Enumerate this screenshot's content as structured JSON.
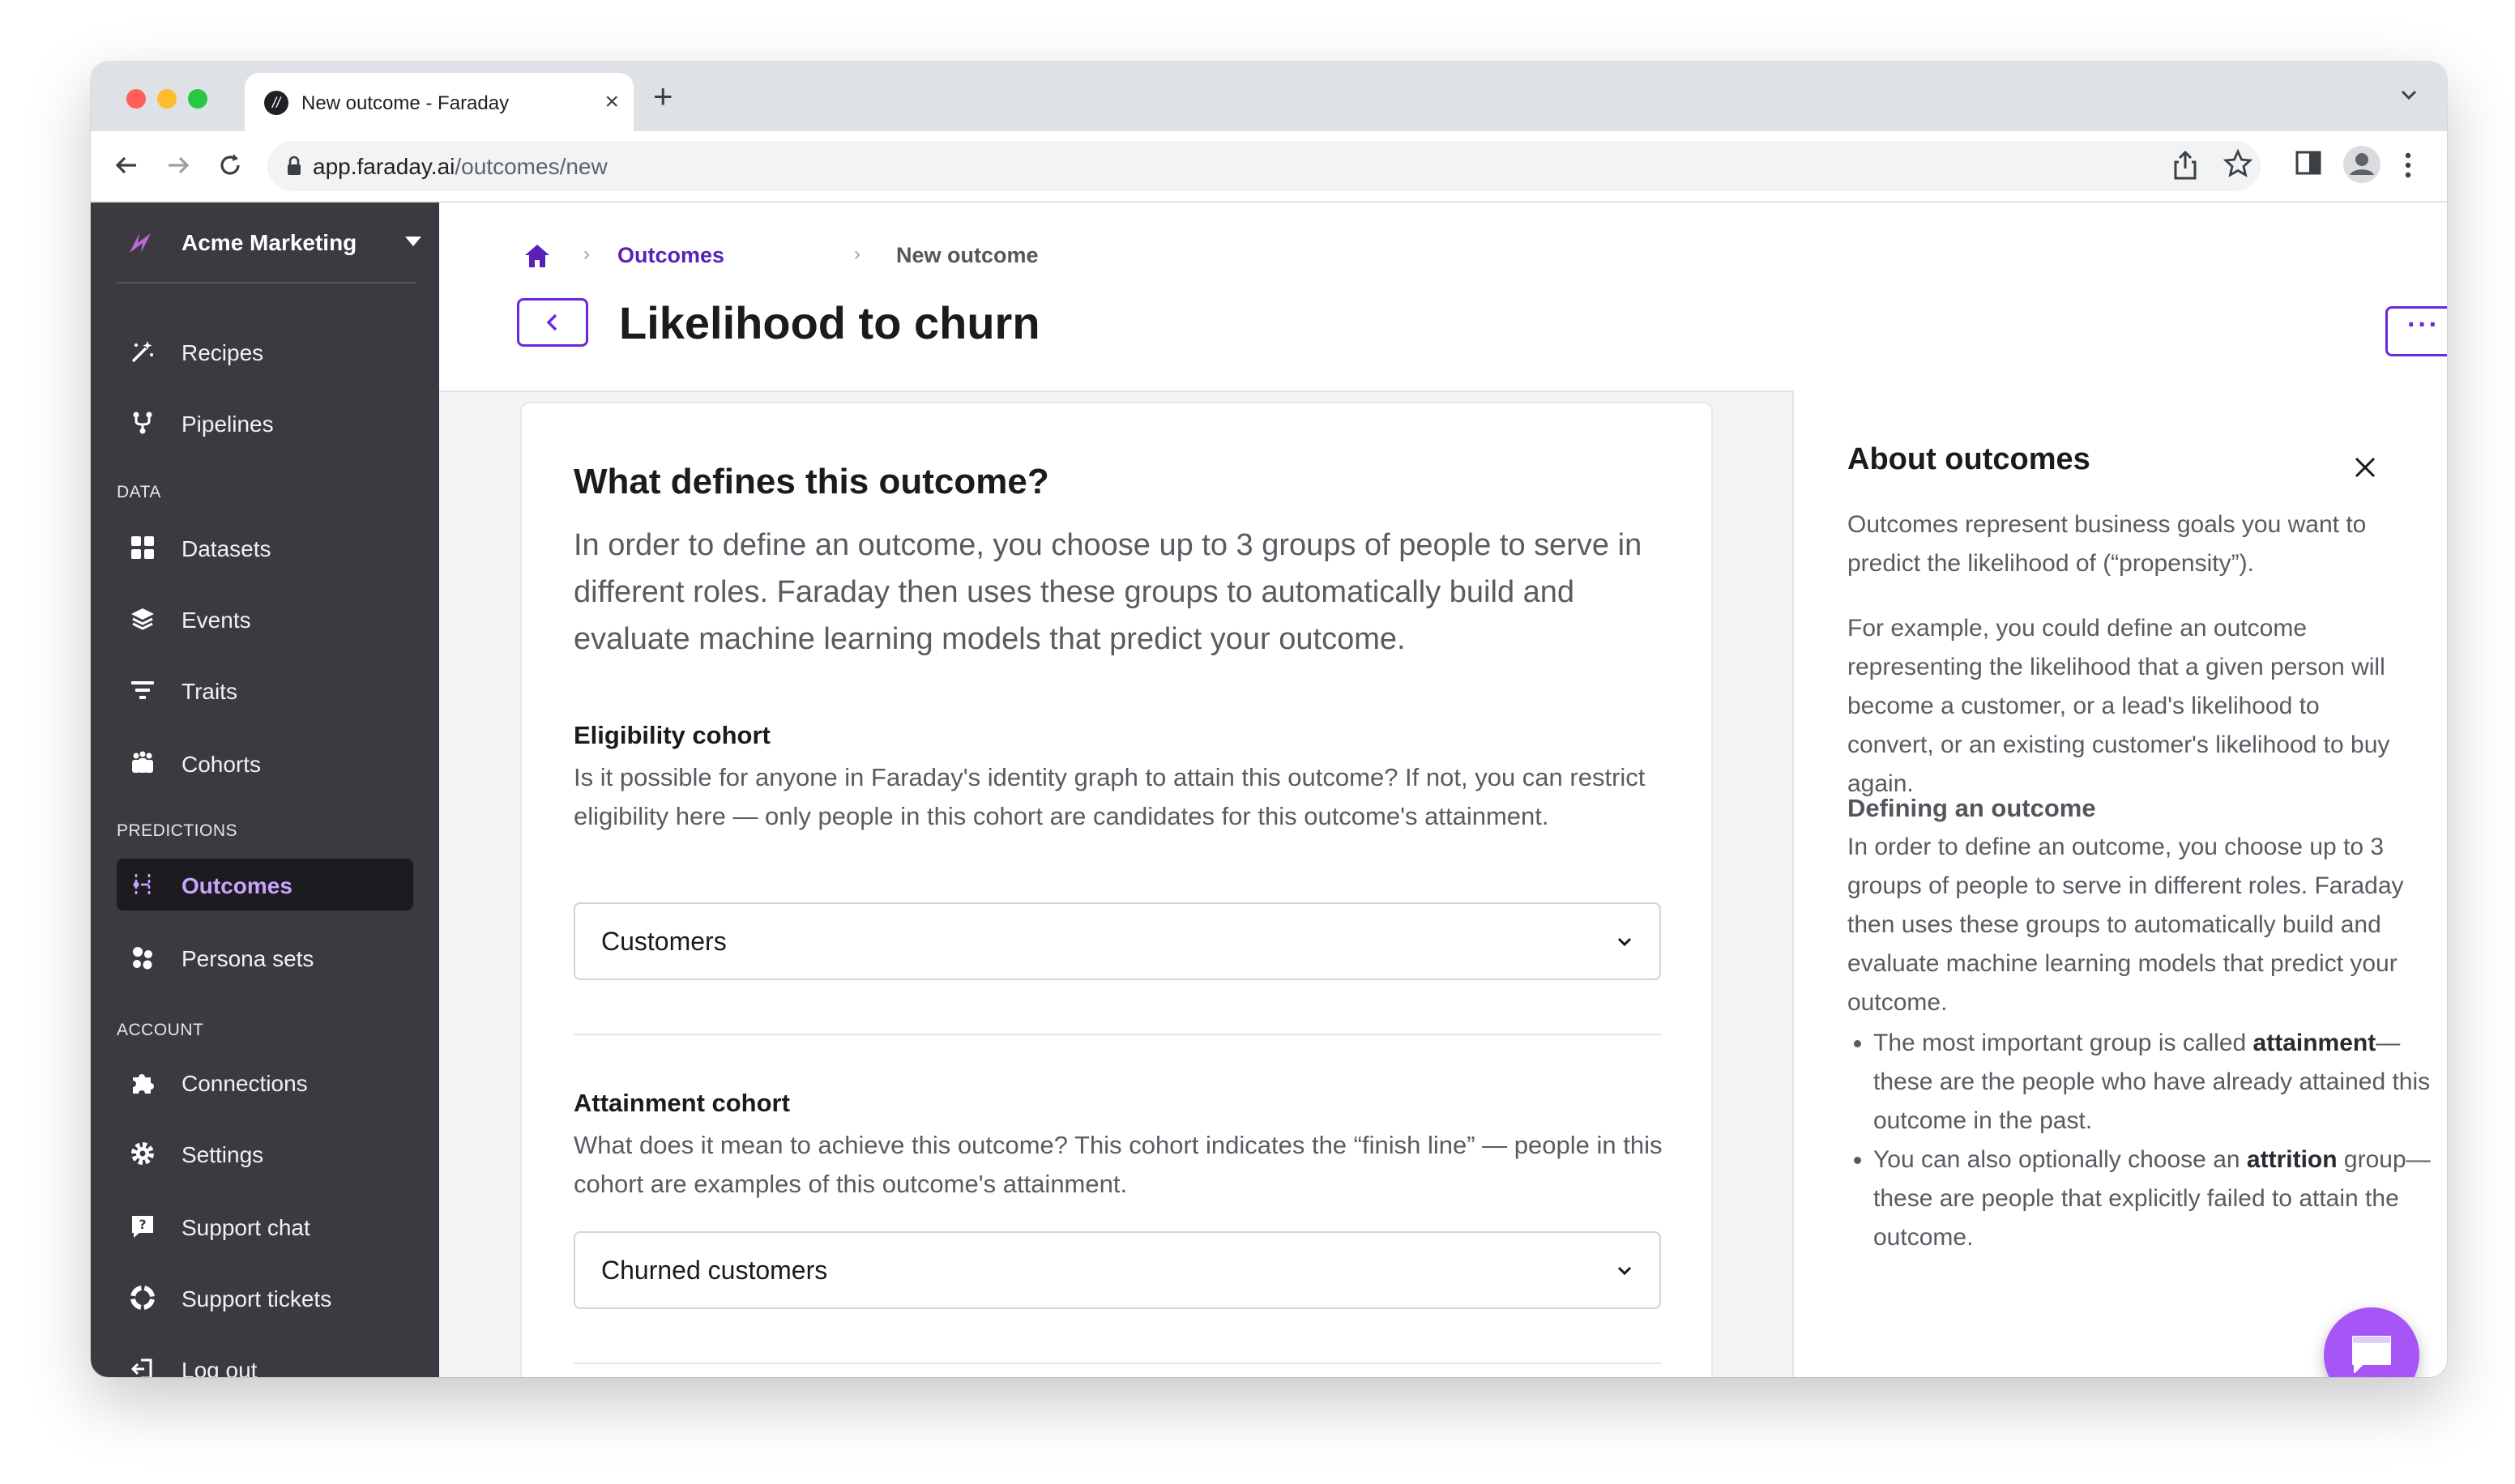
{
  "browser": {
    "tab_title": "New outcome - Faraday",
    "url_host": "app.faraday.ai",
    "url_path": "/outcomes/new"
  },
  "sidebar": {
    "workspace_name": "Acme Marketing",
    "items_top": [
      {
        "label": "Recipes",
        "icon": "magic-wand-icon"
      },
      {
        "label": "Pipelines",
        "icon": "pipeline-icon"
      }
    ],
    "sections": {
      "data": "DATA",
      "predictions": "PREDICTIONS",
      "account": "ACCOUNT"
    },
    "items_data": [
      {
        "label": "Datasets",
        "icon": "grid-icon"
      },
      {
        "label": "Events",
        "icon": "layers-icon"
      },
      {
        "label": "Traits",
        "icon": "filter-icon"
      },
      {
        "label": "Cohorts",
        "icon": "people-icon"
      }
    ],
    "items_predictions": [
      {
        "label": "Outcomes",
        "icon": "outcome-icon",
        "active": true
      },
      {
        "label": "Persona sets",
        "icon": "persona-icon"
      }
    ],
    "items_account": [
      {
        "label": "Connections",
        "icon": "puzzle-icon"
      },
      {
        "label": "Settings",
        "icon": "gear-icon"
      },
      {
        "label": "Support chat",
        "icon": "help-chat-icon"
      },
      {
        "label": "Support tickets",
        "icon": "lifebuoy-icon"
      },
      {
        "label": "Log out",
        "icon": "logout-icon"
      }
    ]
  },
  "header": {
    "breadcrumb_link": "Outcomes",
    "breadcrumb_current": "New outcome",
    "title": "Likelihood to churn",
    "more_label": "···"
  },
  "card": {
    "heading": "What defines this outcome?",
    "intro": "In order to define an outcome, you choose up to 3 groups of people to serve in different roles. Faraday then uses these groups to automatically build and evaluate machine learning models that predict your outcome.",
    "eligibility": {
      "label": "Eligibility cohort",
      "help": "Is it possible for anyone in Faraday's identity graph to attain this outcome? If not, you can restrict eligibility here — only people in this cohort are candidates for this outcome's attainment.",
      "value": "Customers"
    },
    "attainment": {
      "label": "Attainment cohort",
      "help": "What does it mean to achieve this outcome? This cohort indicates the “finish line” — people in this cohort are examples of this outcome's attainment.",
      "value": "Churned customers"
    }
  },
  "about": {
    "heading": "About outcomes",
    "p1": "Outcomes represent business goals you want to predict the likelihood of (“propensity”).",
    "p2": "For example, you could define an outcome representing the likelihood that a given person will become a customer, or a lead's likelihood to convert, or an existing customer's likelihood to buy again.",
    "sub": "Defining an outcome",
    "p3": "In order to define an outcome, you choose up to 3 groups of people to serve in different roles. Faraday then uses these groups to automatically build and evaluate machine learning models that predict your outcome.",
    "bullet1_pre": "The most important group is called ",
    "bullet1_bold": "attainment",
    "bullet1_post": "—these are the people who have already attained this outcome in the past.",
    "bullet2_pre": "You can also optionally choose an ",
    "bullet2_bold": "attrition",
    "bullet2_post": " group—these are people that explicitly failed to attain the outcome."
  },
  "colors": {
    "accent": "#6d28d9",
    "sidebar_bg": "#3b3a40",
    "active_label": "#c8a4ff",
    "chat": "#a855f7"
  }
}
